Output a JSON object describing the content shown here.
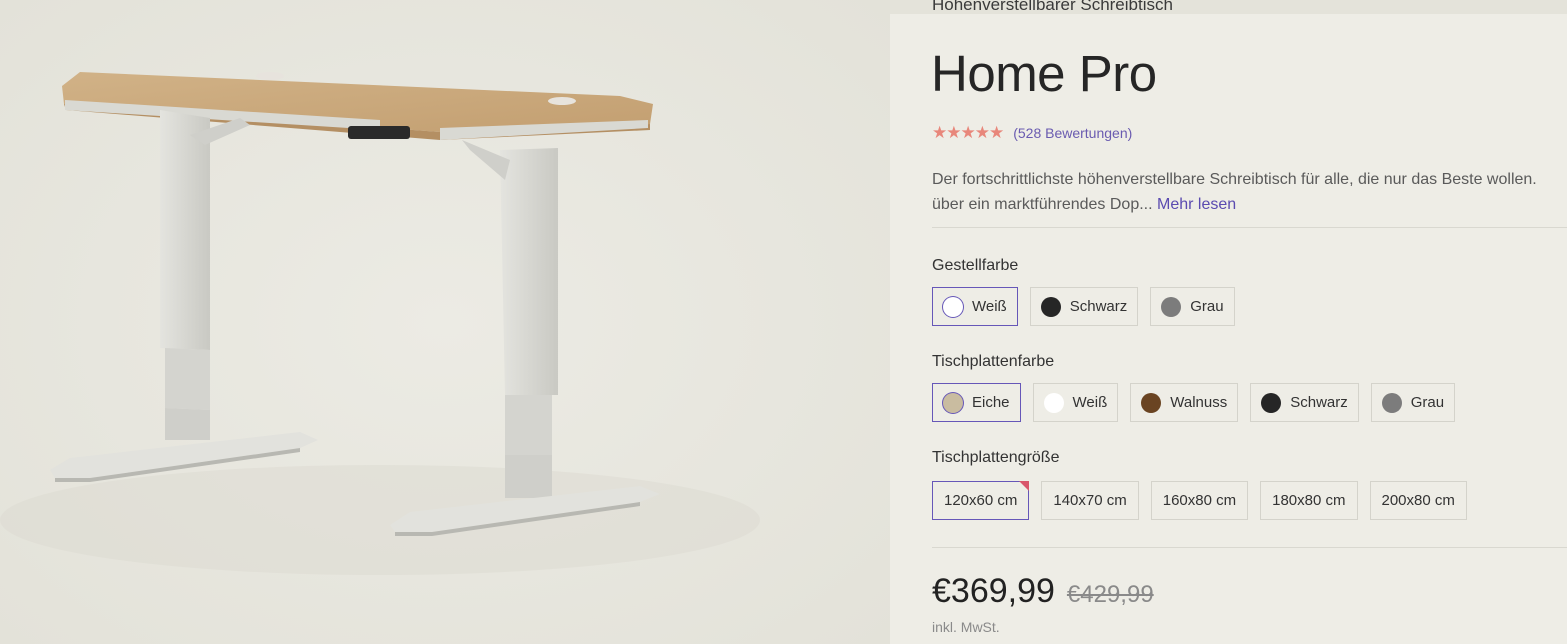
{
  "product": {
    "eyebrow": "Höhenverstellbarer Schreibtisch",
    "title": "Home Pro",
    "rating": {
      "stars_value": 4.5,
      "stars_text": "★★★★★",
      "reviews_text": "(528 Bewertungen)"
    },
    "description": {
      "line1": "Der fortschrittlichste höhenverstellbare Schreibtisch für alle, die nur das Beste wollen.",
      "line2": "über ein marktführendes Dop...",
      "read_more": "Mehr lesen"
    }
  },
  "frame_color": {
    "label": "Gestellfarbe",
    "options": [
      {
        "label": "Weiß",
        "color": "#ffffff",
        "selected": true
      },
      {
        "label": "Schwarz",
        "color": "#262626",
        "selected": false
      },
      {
        "label": "Grau",
        "color": "#7c7c7c",
        "selected": false
      }
    ]
  },
  "top_color": {
    "label": "Tischplattenfarbe",
    "options": [
      {
        "label": "Eiche",
        "color": "#c9bca0",
        "selected": true
      },
      {
        "label": "Weiß",
        "color": "#ffffff",
        "selected": false
      },
      {
        "label": "Walnuss",
        "color": "#6a4422",
        "selected": false
      },
      {
        "label": "Schwarz",
        "color": "#262626",
        "selected": false
      },
      {
        "label": "Grau",
        "color": "#7c7c7c",
        "selected": false
      }
    ]
  },
  "top_size": {
    "label": "Tischplattengröße",
    "options": [
      {
        "label": "120x60 cm",
        "selected": true
      },
      {
        "label": "140x70 cm",
        "selected": false
      },
      {
        "label": "160x80 cm",
        "selected": false
      },
      {
        "label": "180x80 cm",
        "selected": false
      },
      {
        "label": "200x80 cm",
        "selected": false
      }
    ]
  },
  "pricing": {
    "current": "€369,99",
    "original": "€429,99",
    "tax_note": "inkl. MwSt."
  },
  "colors": {
    "accent": "#6657b8",
    "star": "#e8877b",
    "sale_marker": "#d9556a"
  },
  "icons": {
    "rating": "star-icon",
    "color_swatch": "color-swatch-icon"
  }
}
